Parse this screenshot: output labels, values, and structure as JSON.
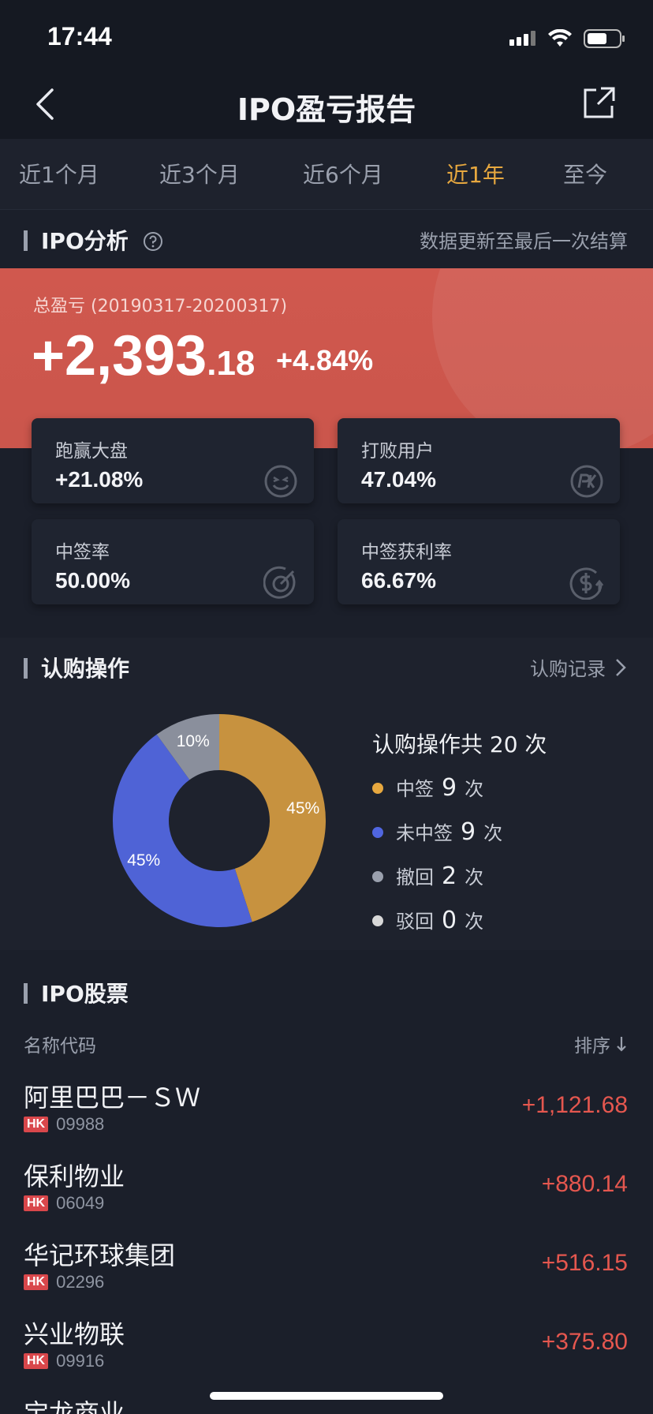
{
  "status": {
    "time": "17:44"
  },
  "nav": {
    "title": "IPO盈亏报告"
  },
  "tabs": [
    "近1个月",
    "近3个月",
    "近6个月",
    "近1年",
    "至今"
  ],
  "active_tab": "近1年",
  "analysis": {
    "title": "IPO分析",
    "note": "数据更新至最后一次结算",
    "total_label": "总盈亏 (20190317-20200317)",
    "total_int": "+2,393",
    "total_dec": ".18",
    "total_pct": "+4.84%",
    "cards": [
      {
        "label": "跑赢大盘",
        "value": "+21.08%"
      },
      {
        "label": "打败用户",
        "value": "47.04%"
      },
      {
        "label": "中签率",
        "value": "50.00%"
      },
      {
        "label": "中签获利率",
        "value": "66.67%"
      }
    ],
    "card_icons": [
      "wink-face-icon",
      "pk-icon",
      "target-icon",
      "dollar-up-icon"
    ]
  },
  "subscription": {
    "title": "认购操作",
    "record_link": "认购记录",
    "summary": "认购操作共 20 次",
    "legend": [
      {
        "label": "中签",
        "count": "9",
        "unit": "次",
        "color": "#e7a83f"
      },
      {
        "label": "未中签",
        "count": "9",
        "unit": "次",
        "color": "#5066e0"
      },
      {
        "label": "撤回",
        "count": "2",
        "unit": "次",
        "color": "#9aa0ad"
      },
      {
        "label": "驳回",
        "count": "0",
        "unit": "次",
        "color": "#d8d8d8"
      }
    ],
    "chart_data": {
      "type": "pie",
      "categories": [
        "中签",
        "未中签",
        "撤回"
      ],
      "values": [
        45,
        45,
        10
      ],
      "labels": [
        "45%",
        "45%",
        "10%"
      ],
      "colors": [
        "#c7923f",
        "#4f63d6",
        "#8a8f9c"
      ]
    }
  },
  "stocks": {
    "title": "IPO股票",
    "col_name": "名称代码",
    "col_sort": "排序",
    "rows": [
      {
        "name": "阿里巴巴－ＳＷ",
        "market": "HK",
        "code": "09988",
        "value": "+1,121.68"
      },
      {
        "name": "保利物业",
        "market": "HK",
        "code": "06049",
        "value": "+880.14"
      },
      {
        "name": "华记环球集团",
        "market": "HK",
        "code": "02296",
        "value": "+516.15"
      },
      {
        "name": "兴业物联",
        "market": "HK",
        "code": "09916",
        "value": "+375.80"
      },
      {
        "name": "宝龙商业",
        "market": "HK",
        "code": "",
        "value": ""
      }
    ]
  }
}
